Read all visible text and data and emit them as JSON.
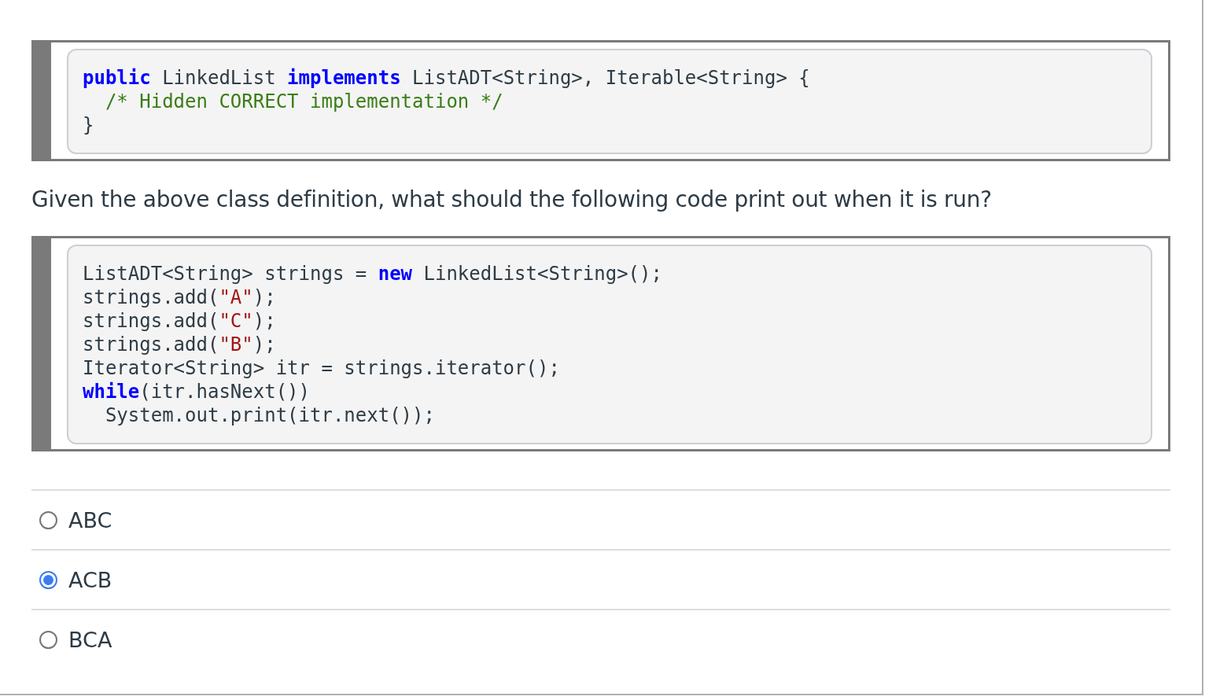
{
  "code_blocks": [
    {
      "lines": [
        [
          {
            "kind": "keyword",
            "text": "public"
          },
          {
            "kind": "plain",
            "text": " LinkedList "
          },
          {
            "kind": "keyword",
            "text": "implements"
          },
          {
            "kind": "plain",
            "text": " ListADT<String>, Iterable<String> {"
          }
        ],
        [
          {
            "kind": "comment",
            "text": "  /* Hidden CORRECT implementation */"
          }
        ],
        [
          {
            "kind": "plain",
            "text": "}"
          }
        ]
      ]
    },
    {
      "lines": [
        [
          {
            "kind": "plain",
            "text": "ListADT<String> strings = "
          },
          {
            "kind": "keyword",
            "text": "new"
          },
          {
            "kind": "plain",
            "text": " LinkedList<String>();"
          }
        ],
        [
          {
            "kind": "plain",
            "text": "strings.add("
          },
          {
            "kind": "string",
            "text": "\"A\""
          },
          {
            "kind": "plain",
            "text": ");"
          }
        ],
        [
          {
            "kind": "plain",
            "text": "strings.add("
          },
          {
            "kind": "string",
            "text": "\"C\""
          },
          {
            "kind": "plain",
            "text": ");"
          }
        ],
        [
          {
            "kind": "plain",
            "text": "strings.add("
          },
          {
            "kind": "string",
            "text": "\"B\""
          },
          {
            "kind": "plain",
            "text": ");"
          }
        ],
        [
          {
            "kind": "plain",
            "text": "Iterator<String> itr = strings.iterator();"
          }
        ],
        [
          {
            "kind": "keyword",
            "text": "while"
          },
          {
            "kind": "plain",
            "text": "(itr.hasNext())"
          }
        ],
        [
          {
            "kind": "plain",
            "text": "  System.out.print(itr.next());"
          }
        ]
      ]
    }
  ],
  "question": "Given the above class definition, what should the following code print out when it is run?",
  "answers": [
    {
      "label": "ABC",
      "selected": false
    },
    {
      "label": "ACB",
      "selected": true
    },
    {
      "label": "BCA",
      "selected": false
    }
  ]
}
